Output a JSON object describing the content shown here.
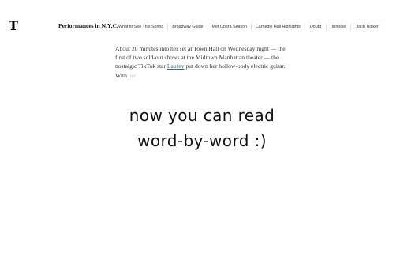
{
  "header": {
    "logo": "T",
    "section_title": "Performances in N.Y.C.",
    "nav": [
      "What to See This Spring",
      "Broadway Guide",
      "Met Opera Season",
      "Carnegie Hall Highlights",
      "‘Doubt’",
      "‘Illinoise’",
      "‘Jack Tucker’"
    ]
  },
  "article": {
    "text_before_link": "About 20 minutes into her set at Town Hall on Wednesday night — the first of two sold-out shows at the Midtown Manhattan theater — the nostalgic TikTok star ",
    "link": "Laufey",
    "text_after_link": " put down her hollow-body electric guitar. With ",
    "faded_word": "her"
  },
  "overlay": {
    "line1": "now you can read",
    "line2": "word-by-word :)"
  },
  "colors": {
    "link": "#326891",
    "body_text": "#333333",
    "faded_text": "#c7c7c7"
  }
}
